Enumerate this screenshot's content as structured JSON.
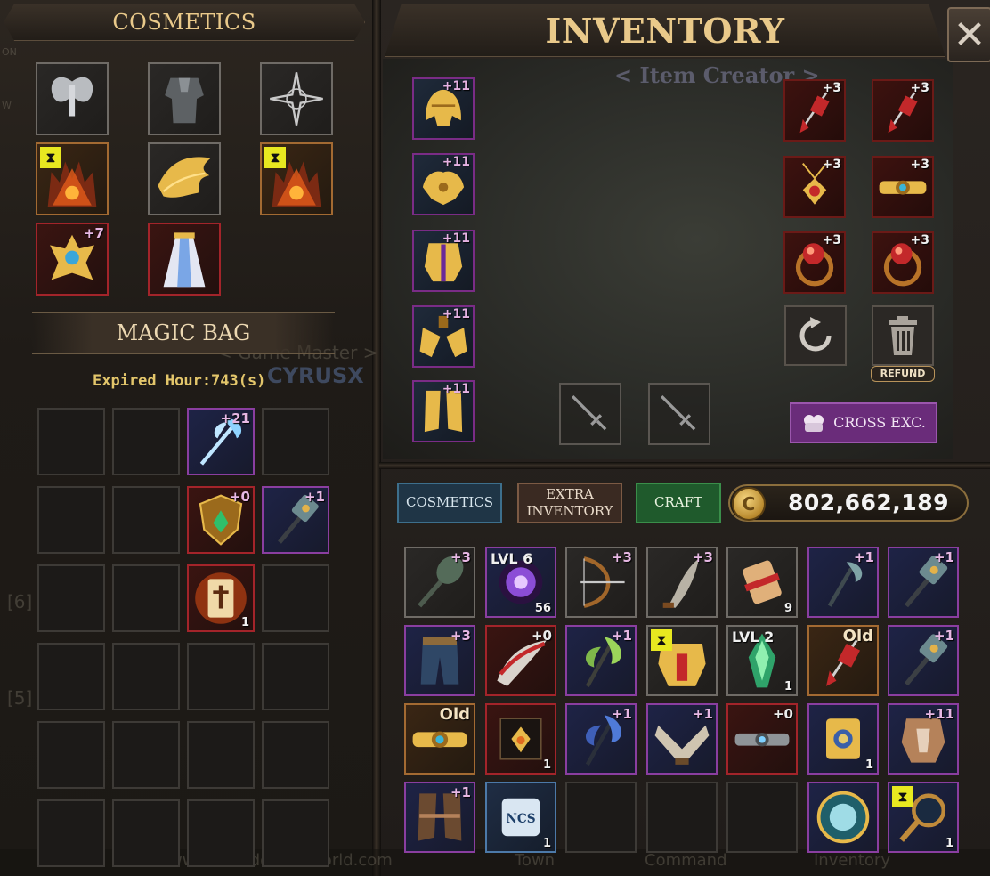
{
  "cosmetics_header": "COSMETICS",
  "inventory_header": "INVENTORY",
  "close_label": "✕",
  "item_creator_label": "< Item Creator >",
  "magic_bag_header": "MAGIC BAG",
  "expired_label": "Expired Hour:743(s)",
  "background_text": {
    "game_master": "< Game Master >",
    "player_name": "CYRUSX",
    "website": "www.kovedonlineworld.com",
    "menu_town": "Town",
    "menu_command": "Command",
    "menu_inventory": "Inventory",
    "side_6": "[6]",
    "side_5": "[5]",
    "corner_top": "ON",
    "corner_w": "W"
  },
  "cosmetics_slots": [
    {
      "icon": "fairy-wings-icon",
      "plus": ""
    },
    {
      "icon": "armor-outfit-icon",
      "plus": ""
    },
    {
      "icon": "compass-emblem-icon",
      "plus": ""
    },
    {
      "icon": "fire-crown-icon",
      "plus": "",
      "timed": true
    },
    {
      "icon": "golden-wings-icon",
      "plus": ""
    },
    {
      "icon": "fire-crown-icon",
      "plus": "",
      "timed": true
    },
    {
      "icon": "golden-crest-icon",
      "plus": "+7"
    },
    {
      "icon": "white-robe-icon",
      "plus": ""
    }
  ],
  "magic_bag": [
    {
      "icon": "",
      "plus": ""
    },
    {
      "icon": "",
      "plus": ""
    },
    {
      "icon": "ice-axe-icon",
      "plus": "+21"
    },
    {
      "icon": "",
      "plus": ""
    },
    {
      "icon": "",
      "plus": ""
    },
    {
      "icon": "",
      "plus": ""
    },
    {
      "icon": "emerald-shield-icon",
      "plus": "+0"
    },
    {
      "icon": "war-hammer-icon",
      "plus": "+1"
    },
    {
      "icon": "",
      "plus": ""
    },
    {
      "icon": "",
      "plus": ""
    },
    {
      "icon": "fire-scroll-icon",
      "plus": "",
      "count": "1"
    },
    {
      "icon": "",
      "plus": ""
    }
  ],
  "equipped_armor": [
    {
      "icon": "golden-helmet-icon",
      "plus": "+11"
    },
    {
      "icon": "golden-pauldron-icon",
      "plus": "+11"
    },
    {
      "icon": "golden-chest-icon",
      "plus": "+11"
    },
    {
      "icon": "golden-gauntlet-icon",
      "plus": "+11"
    },
    {
      "icon": "golden-boots-icon",
      "plus": "+11"
    }
  ],
  "equipped_accessories": [
    {
      "icon": "ruby-earring-icon",
      "plus": "+3"
    },
    {
      "icon": "ruby-earring-icon",
      "plus": "+3"
    },
    {
      "icon": "ruby-pendant-icon",
      "plus": "+3"
    },
    {
      "icon": "golden-belt-icon",
      "plus": "+3"
    },
    {
      "icon": "ruby-ring-icon",
      "plus": "+3"
    },
    {
      "icon": "ruby-ring-icon",
      "plus": "+3"
    }
  ],
  "weapon_slots": [
    "sword-icon",
    "sword-icon"
  ],
  "refund_label": "REFUND",
  "cross_exchange_label": "CROSS EXC.",
  "tabs": {
    "cosmetics": "COSMETICS",
    "extra_inventory": "EXTRA INVENTORY",
    "craft": "CRAFT"
  },
  "gold_amount": "802,662,189",
  "inventory_grid": [
    {
      "icon": "spiked-mace-icon",
      "plus": "+3"
    },
    {
      "icon": "purple-orb-icon",
      "tl": "LVL 6",
      "count": "56"
    },
    {
      "icon": "bow-icon",
      "plus": "+3"
    },
    {
      "icon": "curved-blade-icon",
      "plus": "+3"
    },
    {
      "icon": "red-scroll-icon",
      "count": "9"
    },
    {
      "icon": "halberd-icon",
      "plus": "+1"
    },
    {
      "icon": "war-hammer-icon",
      "plus": "+1"
    },
    {
      "icon": "blue-leggings-icon",
      "plus": "+3"
    },
    {
      "icon": "feather-claw-icon",
      "plus": "+0",
      "plus_white": true
    },
    {
      "icon": "green-axe-icon",
      "plus": "+1"
    },
    {
      "icon": "golden-armor-icon",
      "timed": true
    },
    {
      "icon": "green-shard-icon",
      "tl": "LVL 2",
      "count": "1"
    },
    {
      "icon": "ruby-earring-icon",
      "old": "Old"
    },
    {
      "icon": "war-hammer-icon",
      "plus": "+1"
    },
    {
      "icon": "golden-belt-icon",
      "old": "Old"
    },
    {
      "icon": "amber-pendant-icon",
      "count": "1"
    },
    {
      "icon": "blue-axe-icon",
      "plus": "+1"
    },
    {
      "icon": "crossed-gloves-icon",
      "plus": "+1"
    },
    {
      "icon": "silver-belt-icon",
      "plus": "+0",
      "plus_white": true
    },
    {
      "icon": "golden-scroll-icon",
      "count": "1"
    },
    {
      "icon": "bronze-armor-icon",
      "plus": "+11"
    },
    {
      "icon": "leather-boots-icon",
      "plus": "+1"
    },
    {
      "icon": "ncs-scroll-icon",
      "count": "1"
    },
    {
      "icon": ""
    },
    {
      "icon": ""
    },
    {
      "icon": ""
    },
    {
      "icon": "portal-mirror-icon"
    },
    {
      "icon": "magnifier-icon",
      "count": "1",
      "timed": true
    }
  ],
  "colors": {
    "gold_text": "#e9c98a",
    "accent_purple": "#8a3ea0",
    "accent_red": "#a3242a",
    "tab_blue": "#1f3546",
    "tab_green": "#1f5a2c",
    "tab_brown": "#3a2a22"
  }
}
